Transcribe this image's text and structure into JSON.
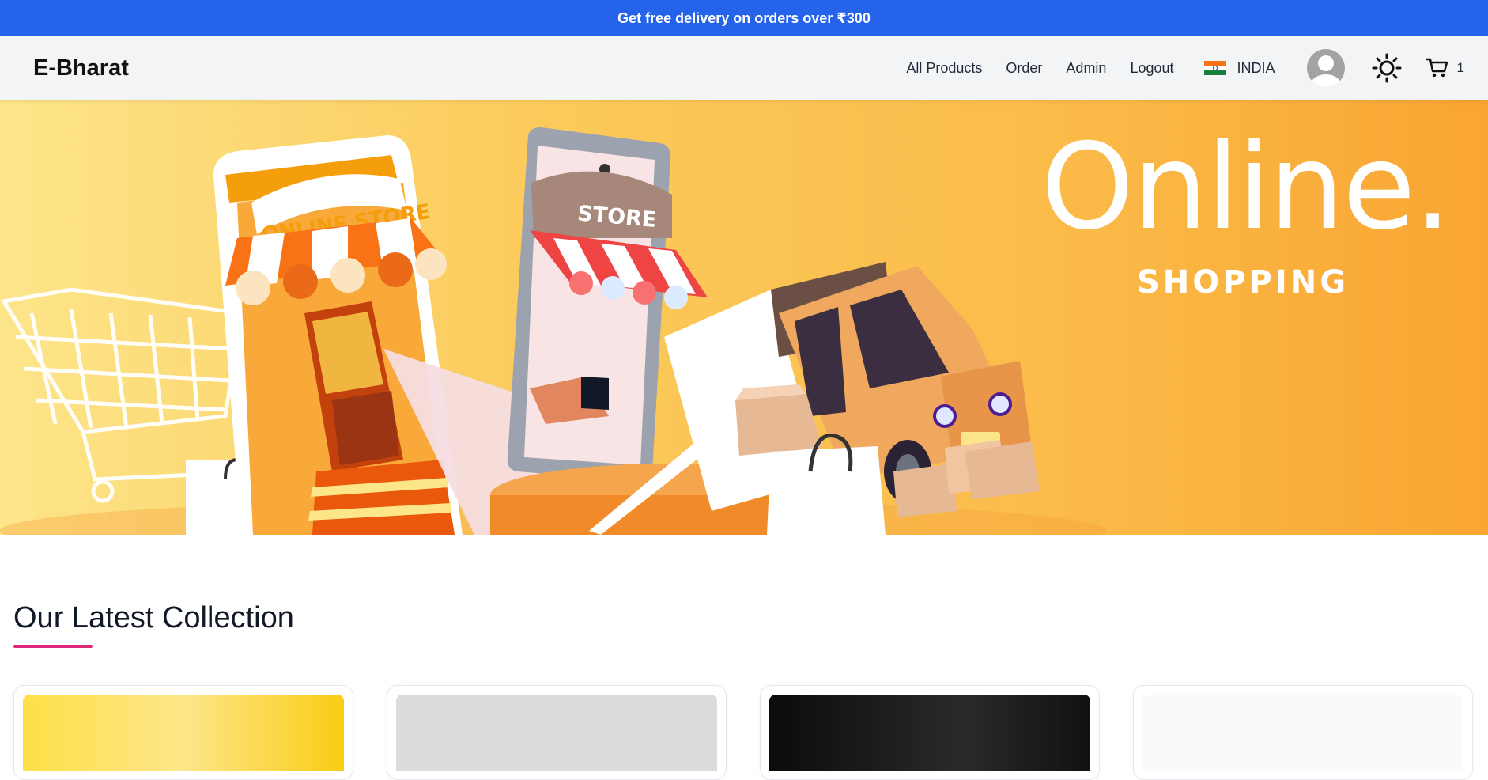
{
  "promo": {
    "text": "Get free delivery on orders over ₹300"
  },
  "navbar": {
    "brand": "E-Bharat",
    "links": [
      "All Products",
      "Order",
      "Admin",
      "Logout"
    ],
    "country": "INDIA",
    "cart_count": "1"
  },
  "hero": {
    "title": "Online.",
    "subtitle": "SHOPPING",
    "store_sign": "ONLINE STORE",
    "phone_sign": "STORE"
  },
  "collection": {
    "title": "Our Latest Collection",
    "accent_color": "#db2777"
  },
  "colors": {
    "promo_bg": "#2563eb",
    "navbar_bg": "#f3f4f6",
    "hero_orange": "#f9a532"
  },
  "icons": [
    "india-flag-icon",
    "avatar-icon",
    "sun-icon",
    "cart-icon"
  ]
}
